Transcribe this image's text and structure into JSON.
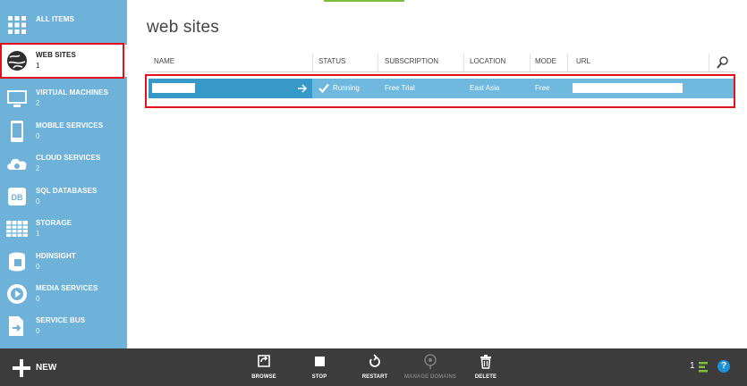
{
  "sidebar": {
    "items": [
      {
        "label": "ALL ITEMS",
        "count": "",
        "icon": "all-items-grid-icon"
      },
      {
        "label": "WEB SITES",
        "count": "1",
        "icon": "globe-icon"
      },
      {
        "label": "VIRTUAL MACHINES",
        "count": "2",
        "icon": "monitor-icon"
      },
      {
        "label": "MOBILE SERVICES",
        "count": "0",
        "icon": "mobile-icon"
      },
      {
        "label": "CLOUD SERVICES",
        "count": "2",
        "icon": "cloud-gear-icon"
      },
      {
        "label": "SQL DATABASES",
        "count": "0",
        "icon": "database-icon"
      },
      {
        "label": "STORAGE",
        "count": "1",
        "icon": "storage-table-icon"
      },
      {
        "label": "HDINSIGHT",
        "count": "0",
        "icon": "hdinsight-icon"
      },
      {
        "label": "MEDIA SERVICES",
        "count": "0",
        "icon": "media-icon"
      },
      {
        "label": "SERVICE BUS",
        "count": "0",
        "icon": "service-bus-icon"
      }
    ]
  },
  "main": {
    "title": "web sites",
    "columns": [
      "NAME",
      "STATUS",
      "SUBSCRIPTION",
      "LOCATION",
      "MODE",
      "URL"
    ],
    "rows": [
      {
        "name": "",
        "status": "Running",
        "subscription": "Free Trial",
        "location": "East Asia",
        "mode": "Free",
        "url": ""
      }
    ]
  },
  "commandbar": {
    "new_label": "NEW",
    "commands": [
      {
        "label": "BROWSE",
        "icon": "browse-icon",
        "enabled": true
      },
      {
        "label": "STOP",
        "icon": "stop-icon",
        "enabled": true
      },
      {
        "label": "RESTART",
        "icon": "restart-icon",
        "enabled": true
      },
      {
        "label": "MANAGE DOMAINS",
        "icon": "manage-domains-icon",
        "enabled": false
      },
      {
        "label": "DELETE",
        "icon": "trash-icon",
        "enabled": true
      }
    ],
    "notification_count": "1",
    "help_label": "?"
  },
  "colors": {
    "sidebar": "#6fb2d9",
    "selected_row": "#3799c8",
    "row": "#6fb8de",
    "commandbar": "#3c3c3c",
    "highlight": "#e3111b",
    "accent": "#7bbf3a"
  }
}
